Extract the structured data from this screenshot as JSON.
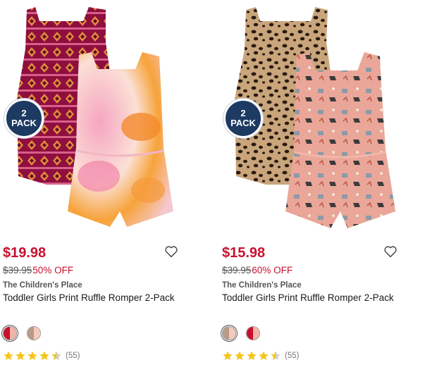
{
  "products": [
    {
      "badge_line1": "2",
      "badge_line2": "PACK",
      "price": "$19.98",
      "original_price": "$39.95",
      "discount": "50% OFF",
      "brand": "The Children's Place",
      "title": "Toddler Girls Print Ruffle Romper 2-Pack",
      "rating_count": "(55)",
      "rating": 4.5,
      "swatches": [
        {
          "left": "#c8102e",
          "right": "#f4b3a8",
          "selected": true
        },
        {
          "left": "#b89b86",
          "right": "#f6c9bd",
          "selected": false
        }
      ],
      "image_colors": {
        "back": "#9c1646",
        "front": "#f7c1c8",
        "accent": "#f39a3a"
      }
    },
    {
      "badge_line1": "2",
      "badge_line2": "PACK",
      "price": "$15.98",
      "original_price": "$39.95",
      "discount": "60% OFF",
      "brand": "The Children's Place",
      "title": "Toddler Girls Print Ruffle Romper 2-Pack",
      "rating_count": "(55)",
      "rating": 4.5,
      "swatches": [
        {
          "left": "#b89b86",
          "right": "#f6c9bd",
          "selected": true
        },
        {
          "left": "#c8102e",
          "right": "#f4b3a8",
          "selected": false
        }
      ],
      "image_colors": {
        "back": "#c8a57a",
        "front": "#e9a99a",
        "accent": "#2b1d14"
      }
    }
  ],
  "colors": {
    "price_red": "#c8102e",
    "badge_navy": "#1d3a63",
    "star_yellow": "#f5c518"
  },
  "icons": [
    "heart-icon",
    "star-icon"
  ]
}
